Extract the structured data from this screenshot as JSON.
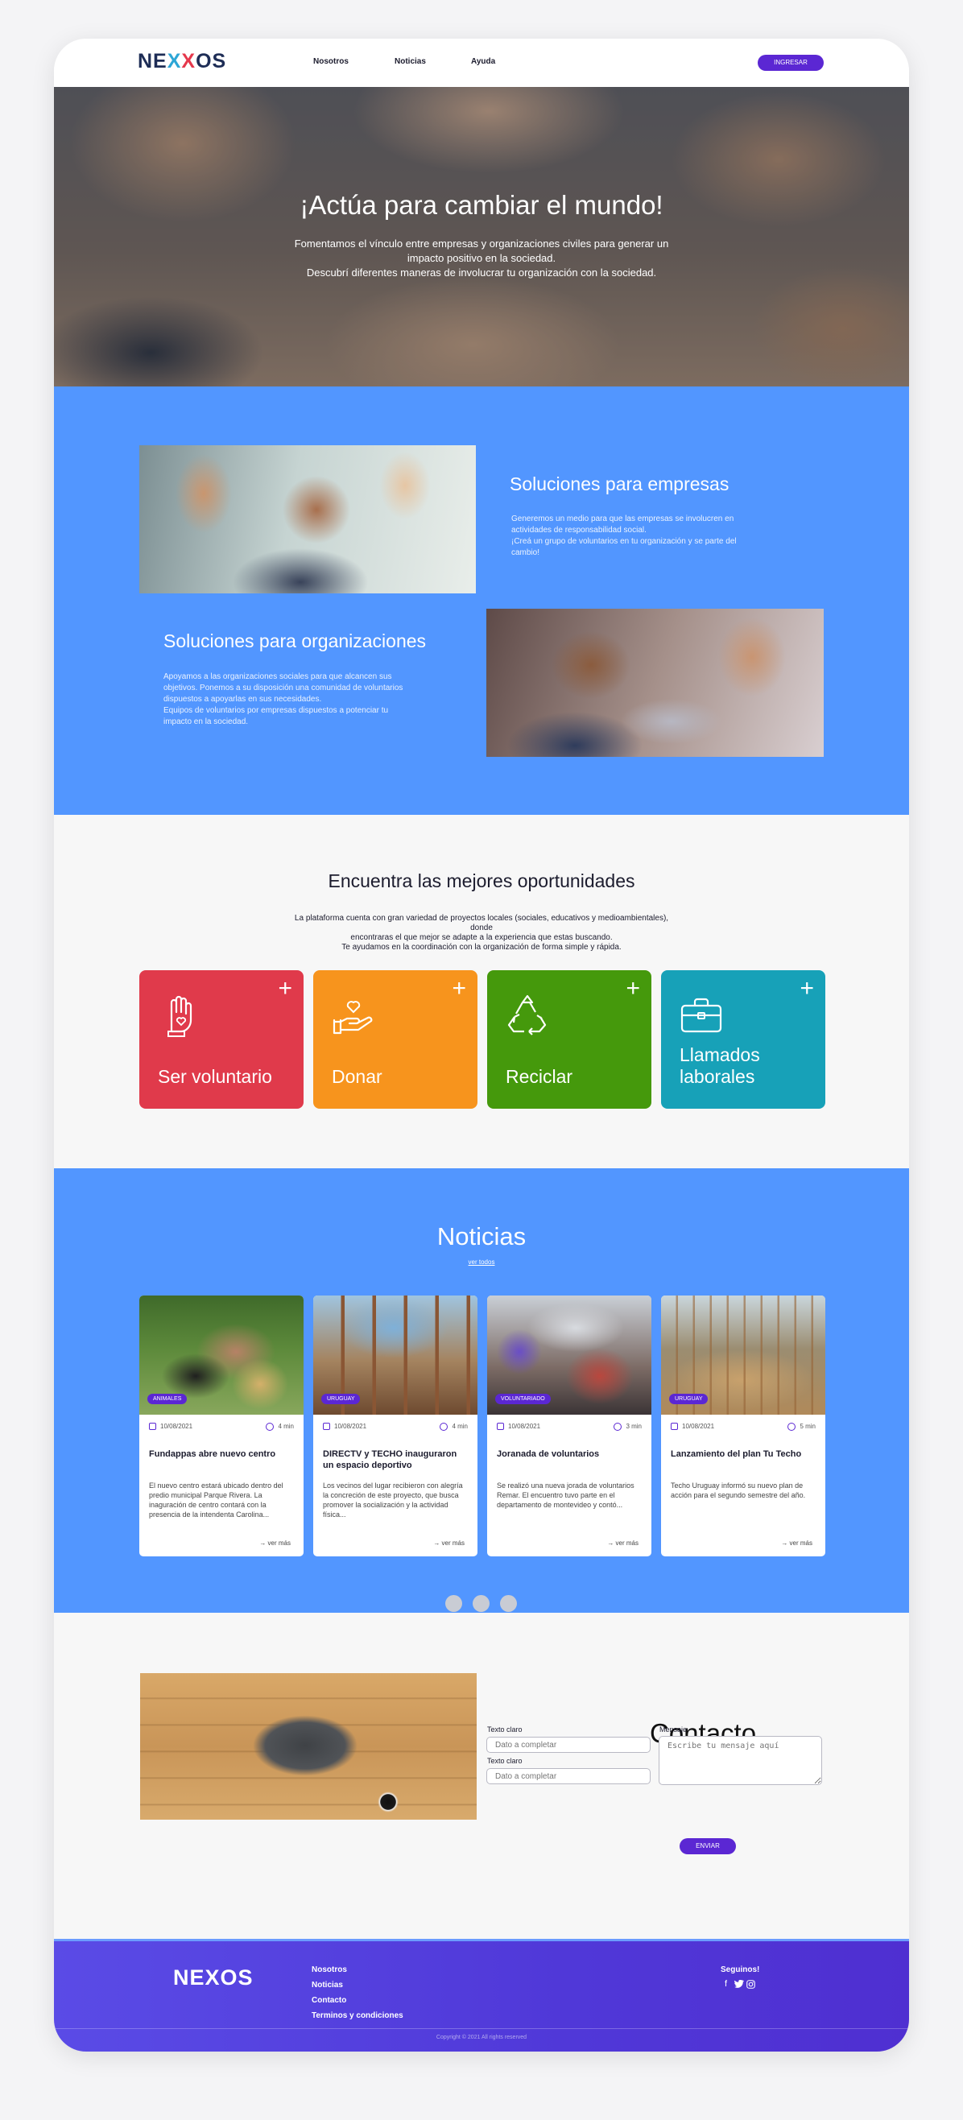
{
  "header": {
    "logo": "NEXOS",
    "nav": [
      "Nosotros",
      "Noticias",
      "Ayuda"
    ],
    "login_label": "INGRESAR"
  },
  "hero": {
    "title": "¡Actúa para cambiar el mundo!",
    "line1": "Fomentamos el vínculo entre empresas y organizaciones civiles para generar un",
    "line2": "impacto positivo en la sociedad.",
    "line3": "Descubrí diferentes maneras de involucrar tu organización con la sociedad."
  },
  "solutions": {
    "companies_title": "Soluciones para empresas",
    "companies_text": [
      "Generemos un medio para que las empresas se involucren en",
      "actividades de responsabilidad social.",
      "¡Creá un grupo de voluntarios en tu organización y se parte del",
      "cambio!"
    ],
    "orgs_title": "Soluciones para organizaciones",
    "orgs_text": [
      "Apoyamos a  las organizaciones sociales para que alcancen sus",
      "objetivos. Ponemos a su disposición una comunidad de voluntarios",
      "dispuestos a apoyarlas en sus necesidades.",
      "Equipos de voluntarios por empresas dispuestos a potenciar tu",
      "impacto en la sociedad."
    ]
  },
  "opportunities": {
    "title": "Encuentra las mejores oportunidades",
    "line1": "La plataforma cuenta con gran variedad de proyectos locales (sociales, educativos y medioambientales), donde",
    "line2": "encontraras el que mejor se adapte a la experiencia que estas buscando.",
    "line3": "Te ayudamos en la coordinación con la organización de forma simple y rápida.",
    "cards": [
      {
        "label": "Ser voluntario",
        "icon": "raised-hand-heart-icon",
        "color": "#e03a4b"
      },
      {
        "label": "Donar",
        "icon": "hand-heart-icon",
        "color": "#f7941d"
      },
      {
        "label": "Reciclar",
        "icon": "recycle-icon",
        "color": "#45990c"
      },
      {
        "label": "Llamados laborales",
        "icon": "briefcase-icon",
        "color": "#17a1b8"
      }
    ],
    "plus": "+"
  },
  "news": {
    "title": "Noticias",
    "see_all": "ver todos",
    "more_label": "ver más",
    "items": [
      {
        "tag": "ANIMALES",
        "date": "10/08/2021",
        "time": "4 min",
        "title": "Fundappas abre nuevo centro",
        "excerpt": "El nuevo centro estará ubicado dentro del predio municipal Parque Rivera. La inaguración de centro contará con la presencia de la intendenta Carolina..."
      },
      {
        "tag": "URUGUAY",
        "date": "10/08/2021",
        "time": "4 min",
        "title": "DIRECTV y TECHO inauguraron un espacio deportivo",
        "excerpt": "Los vecinos del lugar recibieron con alegría la concreción de este proyecto, que busca promover la socialización y la actividad física..."
      },
      {
        "tag": "VOLUNTARIADO",
        "date": "10/08/2021",
        "time": "3 min",
        "title": "Joranada de voluntarios",
        "excerpt": "Se realizó una nueva jorada de voluntarios Remar. El encuentro tuvo parte en el departamento de montevideo y contó..."
      },
      {
        "tag": "URUGUAY",
        "date": "10/08/2021",
        "time": "5 min",
        "title": "Lanzamiento del plan Tu Techo",
        "excerpt": "Techo Uruguay informó su nuevo plan de acción para el segundo semestre del año."
      }
    ]
  },
  "contact": {
    "title": "Contacto",
    "field1_label": "Texto claro",
    "field1_placeholder": "Dato a completar",
    "field2_label": "Texto claro",
    "field2_placeholder": "Dato a completar",
    "message_label": "Mensaje",
    "message_placeholder": "Escribe tu mensaje aquí",
    "send_label": "ENVIAR"
  },
  "footer": {
    "logo": "NEXOS",
    "links": [
      "Nosotros",
      "Noticias",
      "Contacto",
      "Terminos y  condiciones"
    ],
    "follow": "Seguinos!",
    "social": [
      "f",
      "twitter-icon",
      "instagram-icon"
    ],
    "copyright": "Copyright © 2021 All rights reserved"
  }
}
